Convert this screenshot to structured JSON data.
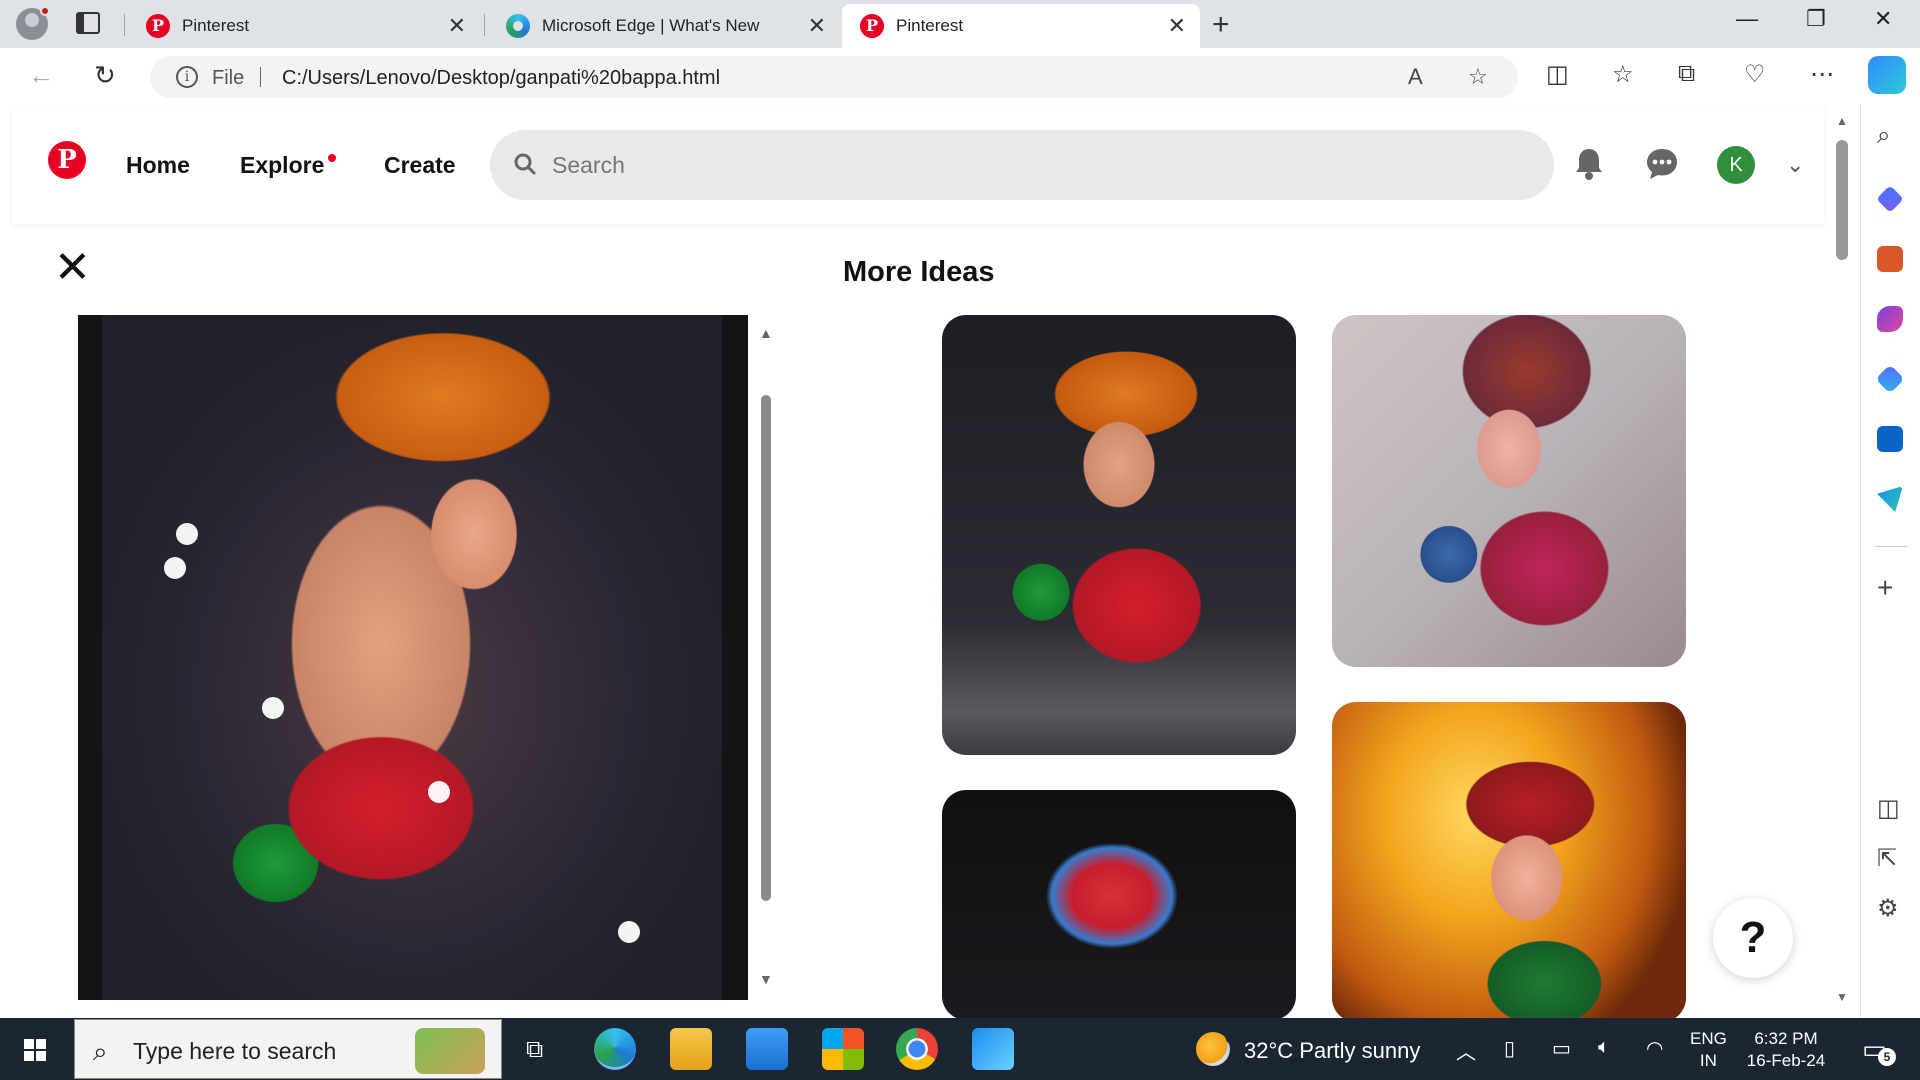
{
  "browser": {
    "tabs": [
      {
        "title": "Pinterest",
        "favicon": "pinterest-icon",
        "active": false
      },
      {
        "title": "Microsoft Edge | What's New",
        "favicon": "edge-icon",
        "active": false
      },
      {
        "title": "Pinterest",
        "favicon": "pinterest-icon",
        "active": true
      }
    ],
    "address": {
      "scheme_label": "File",
      "url": "C:/Users/Lenovo/Desktop/ganpati%20bappa.html"
    }
  },
  "pinterest": {
    "logo_letter": "P",
    "nav": {
      "home": "Home",
      "explore": "Explore",
      "create": "Create"
    },
    "search_placeholder": "Search",
    "avatar_initial": "K",
    "brand_color": "#e60023"
  },
  "content": {
    "close_glyph": "✕",
    "section_title": "More Ideas",
    "main_image": "Ganesha idol with orange turban and red dhoti",
    "pins": [
      "Ganesha idol with orange turban",
      "Ganesha idol with purple fan headdress",
      "Ganesha idol with red fan headdress",
      "Ganesha idol with fiery background"
    ],
    "help_label": "?"
  },
  "taskbar": {
    "search_placeholder": "Type here to search",
    "weather": {
      "temp": "32°C",
      "condition": "Partly sunny"
    },
    "lang_top": "ENG",
    "lang_bottom": "IN",
    "time": "6:32 PM",
    "date": "16-Feb-24",
    "notification_count": "5"
  }
}
